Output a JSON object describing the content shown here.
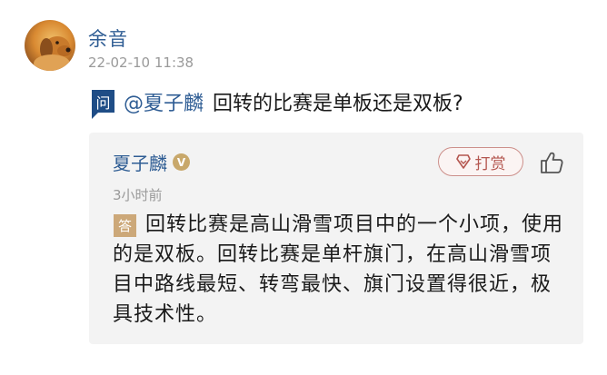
{
  "post": {
    "username": "余音",
    "timestamp": "22-02-10 11:38"
  },
  "question": {
    "badge": "问",
    "mention": "@夏子麟",
    "text": "回转的比赛是单板还是双板?"
  },
  "answer": {
    "answerer": "夏子麟",
    "verified_glyph": "V",
    "reward_label": "打赏",
    "time_ago": "3小时前",
    "badge": "答",
    "text": "回转比赛是高山滑雪项目中的一个小项，使用的是双板。回转比赛是单杆旗门，在高山滑雪项目中路线最短、转弯最快、旗门设置得很近，极具技术性。"
  },
  "icons": {
    "avatar": "dog-avatar",
    "verified": "verified-badge-icon",
    "reward": "diamond-icon",
    "like": "thumbs-up-icon"
  },
  "colors": {
    "link": "#2f5d94",
    "question_badge": "#1f4d86",
    "answer_badge": "#cca879",
    "reward": "#b4564f",
    "card_bg": "#f3f3f3"
  }
}
